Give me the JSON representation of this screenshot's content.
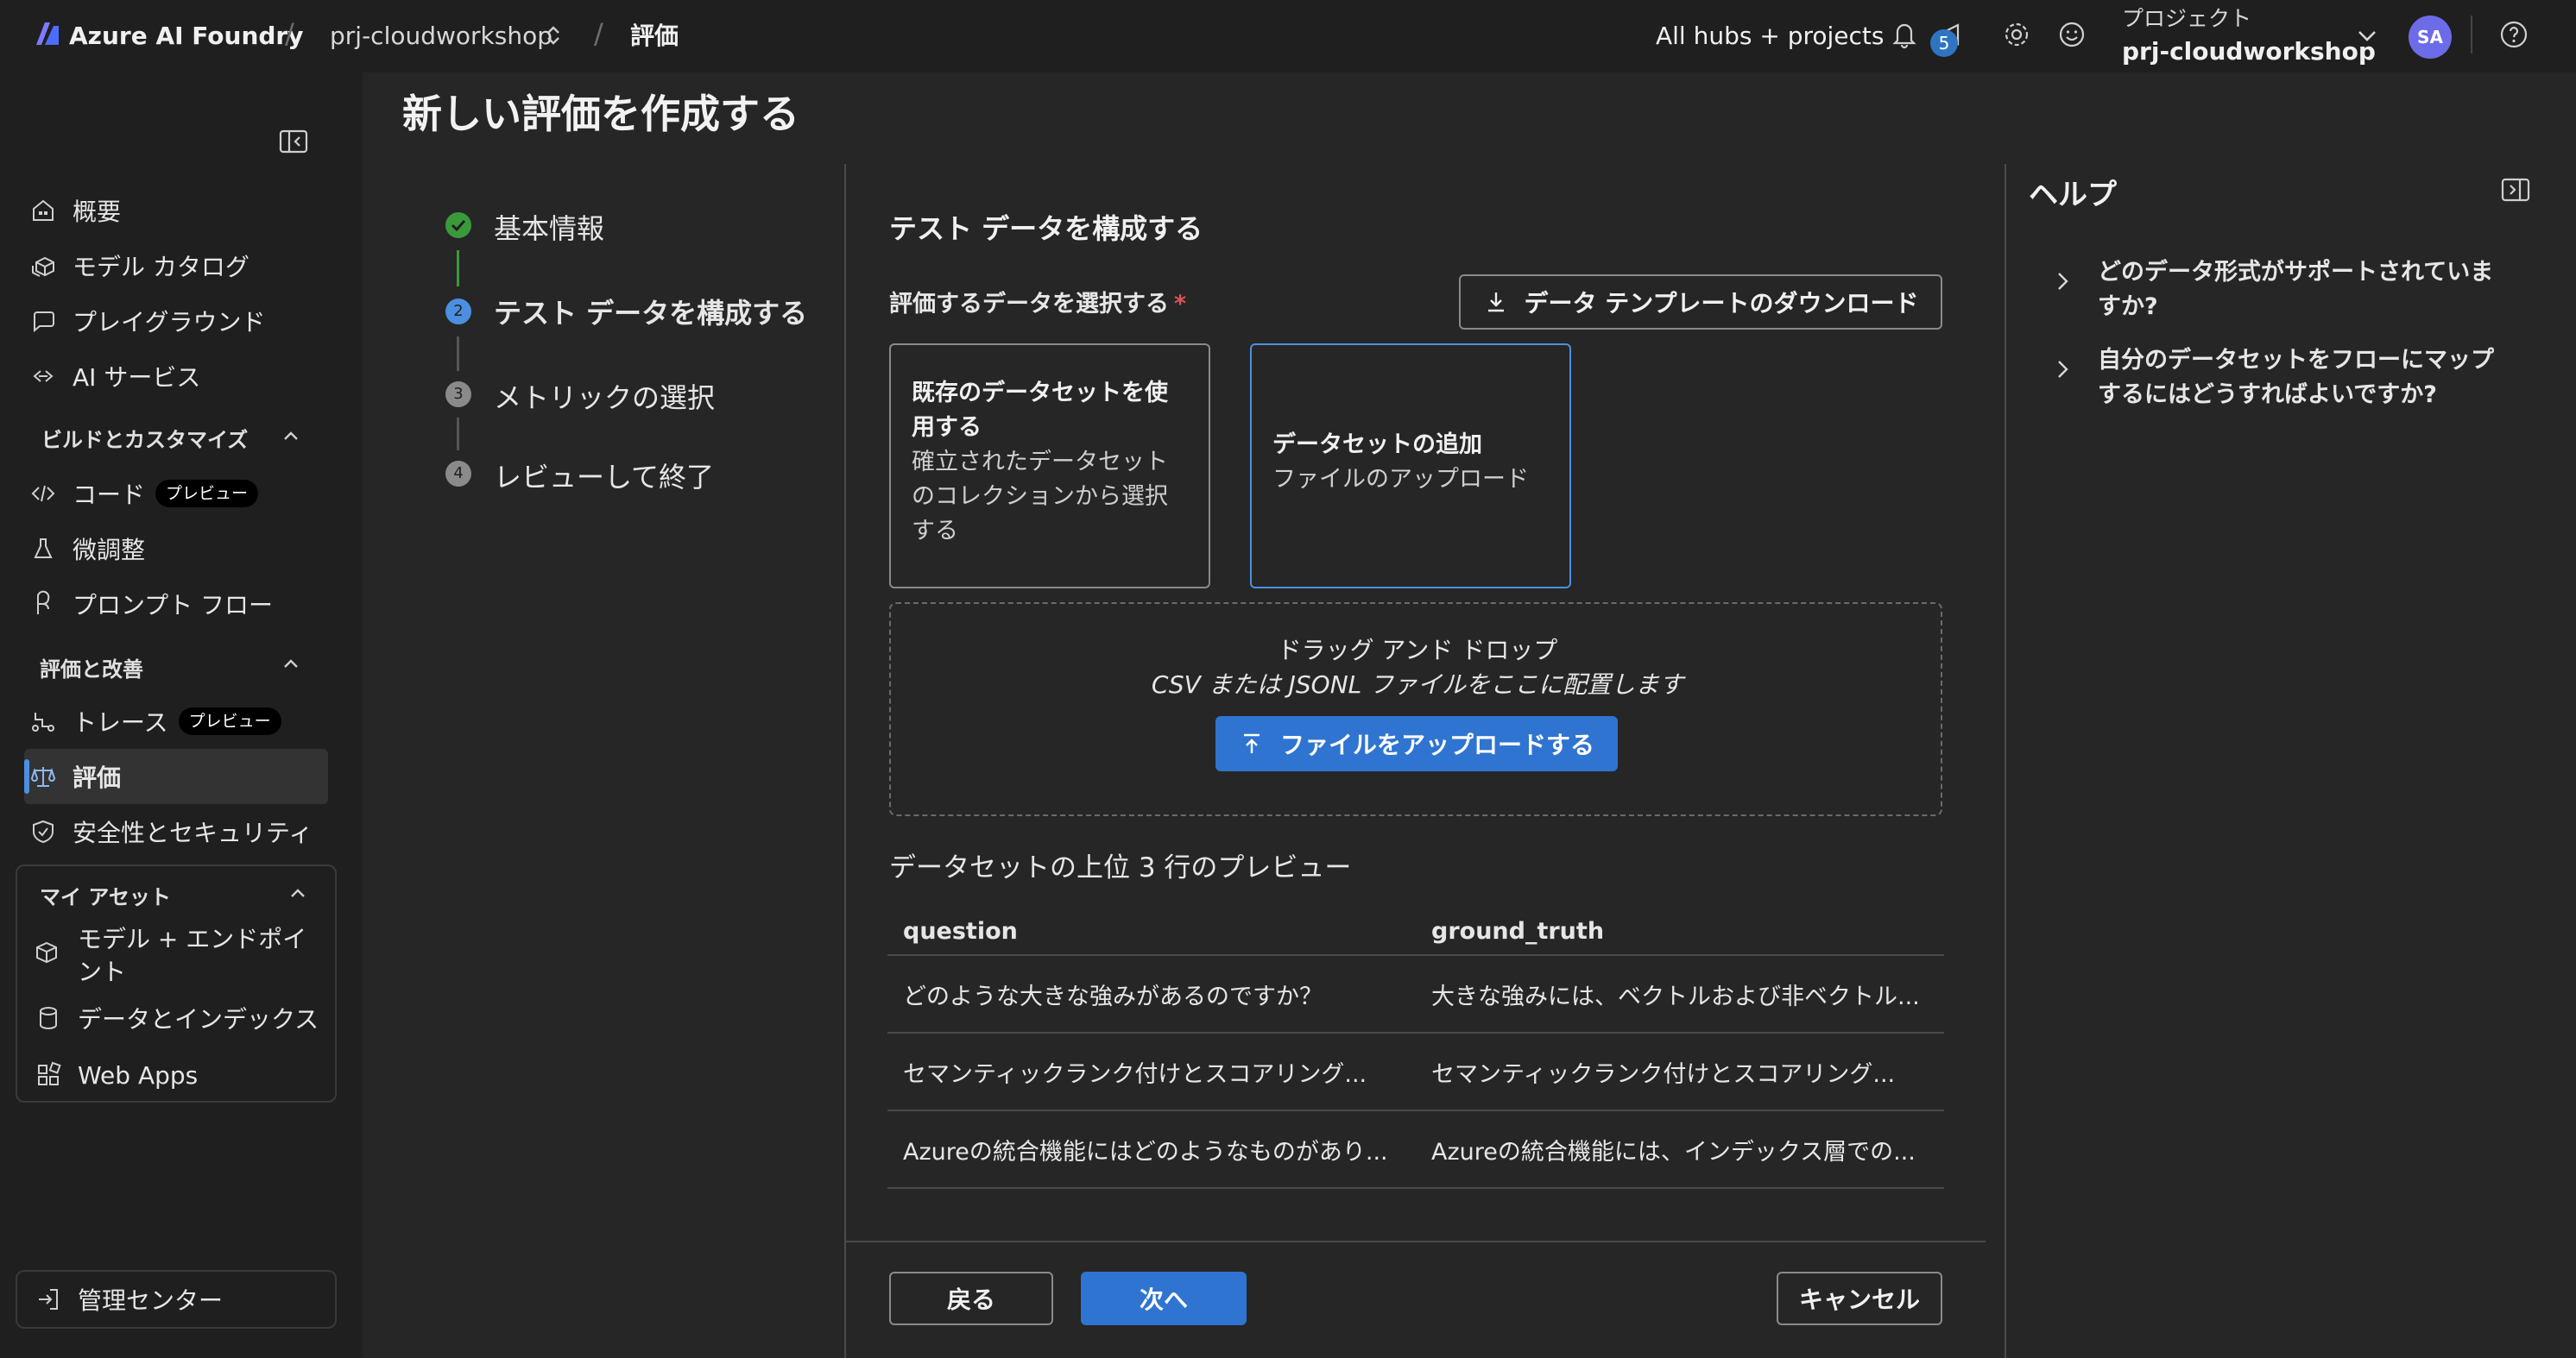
{
  "topbar": {
    "app_name": "Azure AI Foundry",
    "project_crumb": "prj-cloudworkshop",
    "page_crumb": "評価",
    "all_hubs": "All hubs + projects",
    "notification_count": "5",
    "project_caption": "プロジェクト",
    "project_name": "prj-cloudworkshop",
    "avatar_initials": "SA"
  },
  "sidebar": {
    "overview": "概要",
    "model_catalog": "モデル カタログ",
    "playground": "プレイグラウンド",
    "ai_services": "AI サービス",
    "build_section": "ビルドとカスタマイズ",
    "code": "コード",
    "code_badge": "プレビュー",
    "finetune": "微調整",
    "prompt_flow": "プロンプト フロー",
    "eval_section": "評価と改善",
    "trace": "トレース",
    "trace_badge": "プレビュー",
    "evaluation": "評価",
    "safety": "安全性とセキュリティ",
    "assets_section": "マイ アセット",
    "models_endpoints": "モデル + エンドポイント",
    "data_indexes": "データとインデックス",
    "web_apps": "Web Apps",
    "admin_center": "管理センター"
  },
  "page": {
    "title": "新しい評価を作成する"
  },
  "stepper": {
    "steps": [
      {
        "num": "",
        "label": "基本情報",
        "state": "done"
      },
      {
        "num": "2",
        "label": "テスト データを構成する",
        "state": "active"
      },
      {
        "num": "3",
        "label": "メトリックの選択",
        "state": "pending"
      },
      {
        "num": "4",
        "label": "レビューして終了",
        "state": "pending"
      }
    ]
  },
  "config": {
    "section_title": "テスト データを構成する",
    "select_label": "評価するデータを選択する",
    "required_mark": "*",
    "download_template": "データ テンプレートのダウンロード",
    "options": [
      {
        "title_line1": "既存のデータセットを使",
        "title_line2": "用する",
        "desc_line1": "確立されたデータセット",
        "desc_line2": "のコレクションから選択",
        "desc_line3": "する"
      },
      {
        "title": "データセットの追加",
        "desc": "ファイルのアップロード"
      }
    ],
    "dropzone_title": "ドラッグ アンド ドロップ",
    "dropzone_sub": "CSV または JSONL ファイルをここに配置します",
    "upload_button": "ファイルをアップロードする",
    "preview_title": "データセットの上位 3 行のプレビュー",
    "table": {
      "headers": [
        "question",
        "ground_truth"
      ],
      "rows": [
        [
          "どのような大きな強みがあるのですか？",
          "大きな強みには、ベクトルおよび非ベクトル..."
        ],
        [
          "セマンティックランク付けとスコアリング...",
          "セマンティックランク付けとスコアリング..."
        ],
        [
          "Azureの統合機能にはどのようなものがあり...",
          "Azureの統合機能には、インデックス層での..."
        ]
      ]
    },
    "back": "戻る",
    "next": "次へ",
    "cancel": "キャンセル"
  },
  "help": {
    "title": "ヘルプ",
    "items": [
      {
        "line1": "どのデータ形式がサポートされていま",
        "line2": "すか?"
      },
      {
        "line1": "自分のデータセットをフローにマップ",
        "line2": "するにはどうすればよいですか?"
      }
    ]
  },
  "colors": {
    "accent": "#2f74d0",
    "success": "#3a9a3a",
    "background": "#1f1f1f"
  }
}
